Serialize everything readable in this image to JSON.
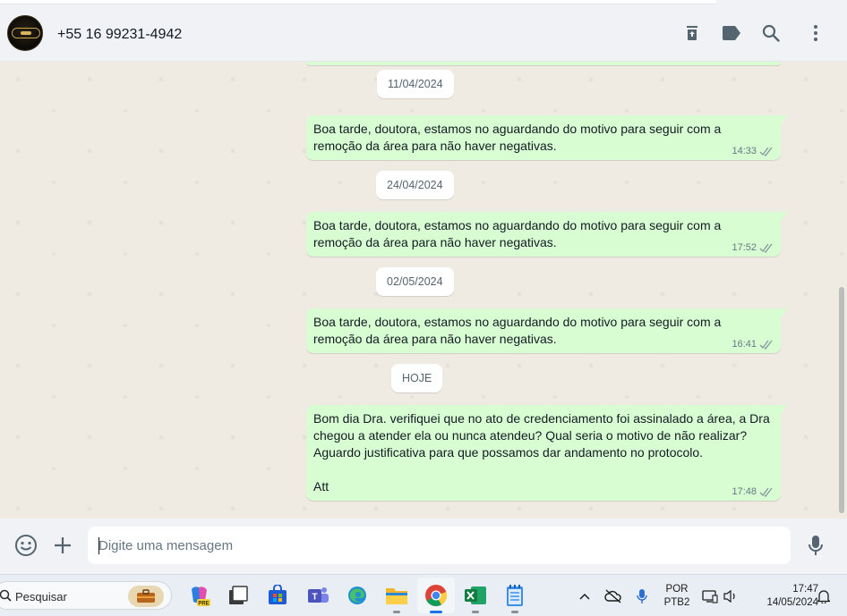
{
  "header": {
    "contact_name": "+55 16 99231-4942",
    "icons": [
      "archive-icon",
      "label-icon",
      "search-icon",
      "menu-icon"
    ]
  },
  "chat": {
    "dates": [
      "11/04/2024",
      "24/04/2024",
      "02/05/2024",
      "HOJE"
    ],
    "messages": [
      {
        "text": "Boa tarde, doutora, estamos no aguardando do motivo para seguir com a remoção da área para não haver negativas.",
        "time": "14:33",
        "status": "read-double-check"
      },
      {
        "text": "Boa tarde, doutora, estamos no aguardando do motivo para seguir com a remoção da área para não haver negativas.",
        "time": "17:52",
        "status": "read-double-check"
      },
      {
        "text": "Boa tarde, doutora, estamos no aguardando do motivo para seguir com a remoção da área para não haver negativas.",
        "time": "16:41",
        "status": "read-double-check"
      },
      {
        "text": "Bom dia Dra. verifiquei que no ato de credenciamento foi assinalado a área, a Dra chegou a atender ela ou nunca atendeu? Qual seria o motivo de não realizar? Aguardo justificativa para que possamos dar andamento no protocolo.\n\nAtt",
        "time": "17:48",
        "status": "read-double-check"
      }
    ],
    "colors": {
      "outgoing_bubble": "#d9fdd3",
      "wallpaper": "#efeae2"
    }
  },
  "composer": {
    "placeholder": "Digite uma mensagem",
    "icons": [
      "emoji-icon",
      "attach-plus-icon",
      "microphone-icon"
    ]
  },
  "taskbar": {
    "search_label": "Pesquisar",
    "apps": [
      "copilot-pre",
      "task-view",
      "microsoft-store",
      "teams",
      "edge",
      "file-explorer",
      "chrome",
      "excel",
      "notepad"
    ],
    "language_line1": "POR",
    "language_line2": "PTB2",
    "time": "17:47",
    "date": "14/05/2024"
  }
}
